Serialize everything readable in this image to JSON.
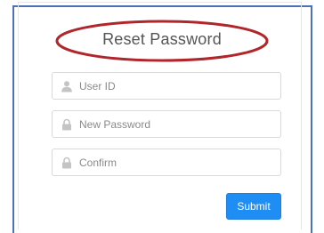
{
  "form": {
    "title": "Reset Password",
    "fields": [
      {
        "icon": "user-icon",
        "placeholder": "User ID",
        "value": ""
      },
      {
        "icon": "lock-icon",
        "placeholder": "New Password",
        "value": ""
      },
      {
        "icon": "lock-icon",
        "placeholder": "Confirm",
        "value": ""
      }
    ],
    "submit_label": "Submit"
  },
  "colors": {
    "accent": "#1e8ef5",
    "highlight_ellipse": "#b0262a",
    "card_border": "#4a72b8"
  }
}
